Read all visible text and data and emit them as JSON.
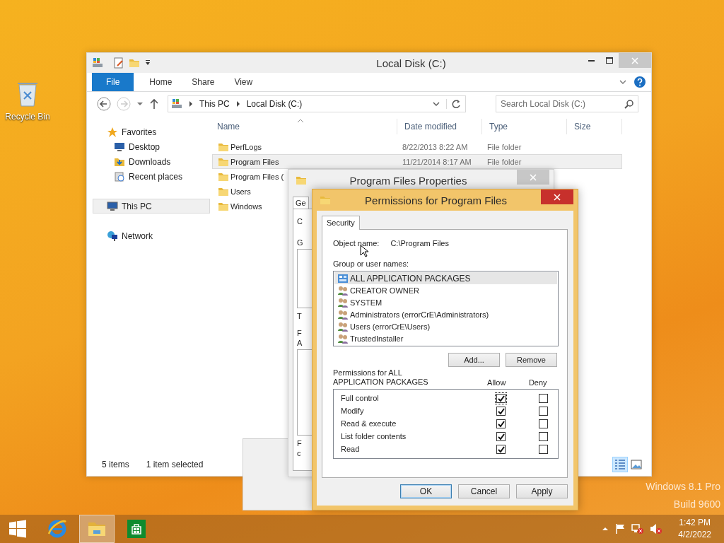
{
  "desktop": {
    "icons": [
      {
        "label": "Recycle Bin",
        "kind": "recycle"
      }
    ],
    "edition_text": [
      "Windows 8.1 Pro",
      "Build 9600"
    ]
  },
  "explorer": {
    "title": "Local Disk (C:)",
    "ribbon_tabs": [
      {
        "label": "File",
        "kind": "file"
      },
      {
        "label": "Home",
        "kind": "tab"
      },
      {
        "label": "Share",
        "kind": "tab"
      },
      {
        "label": "View",
        "kind": "tab"
      }
    ],
    "address": [
      "This PC",
      "Local Disk (C:)"
    ],
    "search": {
      "placeholder": "Search Local Disk (C:)"
    },
    "nav": [
      {
        "label": "Favorites",
        "kind": "star",
        "selected": false,
        "children": [
          {
            "label": "Desktop",
            "kind": "desktop",
            "selected": false
          },
          {
            "label": "Downloads",
            "kind": "downloads",
            "selected": false
          },
          {
            "label": "Recent places",
            "kind": "recent",
            "selected": false
          }
        ]
      },
      {
        "label": "This PC",
        "kind": "pc",
        "selected": true
      },
      {
        "label": "Network",
        "kind": "network",
        "selected": false
      }
    ],
    "columns": [
      "Name",
      "Date modified",
      "Type",
      "Size"
    ],
    "rows": [
      {
        "name": "PerfLogs",
        "date": "8/22/2013 8:22 AM",
        "type": "File folder",
        "selected": false
      },
      {
        "name": "Program Files",
        "date": "11/21/2014 8:17 AM",
        "type": "File folder",
        "selected": true
      },
      {
        "name": "Program Files (",
        "selected": false
      },
      {
        "name": "Users",
        "selected": false
      },
      {
        "name": "Windows",
        "selected": false
      }
    ],
    "status": [
      "5 items",
      "1 item selected"
    ],
    "views": [
      {
        "kind": "details",
        "selected": true
      },
      {
        "kind": "thumbnails",
        "selected": false
      }
    ]
  },
  "properties_window": {
    "title": "Program Files Properties",
    "tab": "Ge",
    "fragments": [
      "C",
      "G",
      "T",
      "F",
      "A",
      "F",
      "c"
    ]
  },
  "permissions_dialog": {
    "title": "Permissions for Program Files",
    "tabs": [
      {
        "label": "Security",
        "selected": true
      }
    ],
    "object_label": "Object name:",
    "object_value": "C:\\Program Files",
    "group_label": "Group or user names:",
    "principals": [
      {
        "name": "ALL APPLICATION PACKAGES",
        "kind": "package",
        "selected": true
      },
      {
        "name": "CREATOR OWNER",
        "kind": "users",
        "selected": false
      },
      {
        "name": "SYSTEM",
        "kind": "users",
        "selected": false
      },
      {
        "name": "Administrators (errorCrE\\Administrators)",
        "kind": "users",
        "selected": false
      },
      {
        "name": "Users (errorCrE\\Users)",
        "kind": "users",
        "selected": false
      },
      {
        "name": "TrustedInstaller",
        "kind": "users",
        "selected": false
      }
    ],
    "principal_buttons": [
      "Add...",
      "Remove"
    ],
    "permissions_heading": [
      "Permissions for ALL",
      "APPLICATION PACKAGES"
    ],
    "allow_label": "Allow",
    "deny_label": "Deny",
    "entries": [
      {
        "name": "Full control",
        "allow": true,
        "deny": false
      },
      {
        "name": "Modify",
        "allow": true,
        "deny": false
      },
      {
        "name": "Read & execute",
        "allow": true,
        "deny": false
      },
      {
        "name": "List folder contents",
        "allow": true,
        "deny": false
      },
      {
        "name": "Read",
        "allow": true,
        "deny": false
      }
    ],
    "buttons": [
      {
        "label": "OK",
        "default": true
      },
      {
        "label": "Cancel",
        "default": false
      },
      {
        "label": "Apply",
        "default": false
      }
    ]
  },
  "taskbar": {
    "apps": [
      {
        "kind": "ie",
        "selected": false
      },
      {
        "kind": "explorer",
        "selected": true
      },
      {
        "kind": "store",
        "selected": false
      }
    ],
    "time": "1:42 PM",
    "date": "4/2/2022"
  }
}
